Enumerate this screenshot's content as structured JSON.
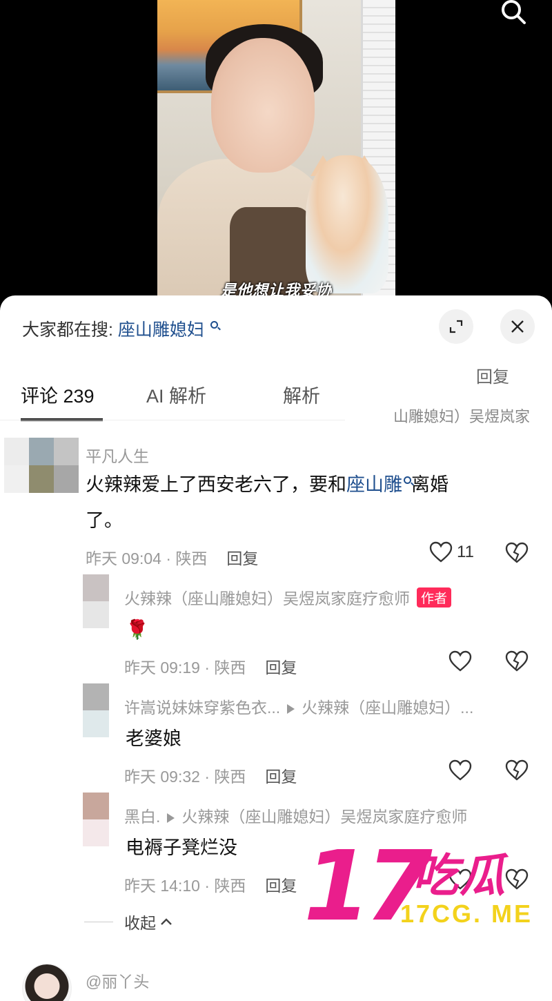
{
  "video": {
    "subtitle": "是他想让我妥协"
  },
  "sheet": {
    "search_prefix": "大家都在搜:",
    "search_query": "座山雕媳妇"
  },
  "tabs": [
    {
      "label": "评论 239"
    },
    {
      "label": "AI 解析"
    },
    {
      "label": "解析"
    }
  ],
  "ghost": {
    "reply": "回复",
    "author": "山雕媳妇）吴煜岚家"
  },
  "comments": {
    "main": {
      "author": "平凡人生",
      "text_before": "火辣辣爱上了西安老六了，要和",
      "link": "座山雕",
      "text_after": "离婚",
      "text_line2": "了。",
      "time": "昨天 09:04 · 陕西",
      "reply": "回复",
      "likes": "11"
    },
    "replies": [
      {
        "author": "火辣辣（座山雕媳妇）吴煜岚家庭疗愈师",
        "badge": "作者",
        "text": "🌹",
        "time": "昨天 09:19 · 陕西",
        "reply": "回复"
      },
      {
        "author": "许嵩说妹妹穿紫色衣...",
        "reply_to": "火辣辣（座山雕媳妇）...",
        "text": "老婆娘",
        "time": "昨天 09:32 · 陕西",
        "reply": "回复"
      },
      {
        "author": "黑白.",
        "reply_to": "火辣辣（座山雕媳妇）吴煜岚家庭疗愈师",
        "text": "电褥子凳烂没",
        "time": "昨天 14:10 · 陕西",
        "reply": "回复"
      }
    ],
    "collapse_label": "收起",
    "next_author": "@丽丫头"
  },
  "watermark": {
    "number": "17",
    "chinese": "吃瓜",
    "url": "17CG. ME"
  },
  "colors": {
    "link": "#1f4f8e",
    "badge": "#ff2b5a",
    "watermark_pink": "#ea1e8c",
    "watermark_yellow": "#f3d21c"
  }
}
